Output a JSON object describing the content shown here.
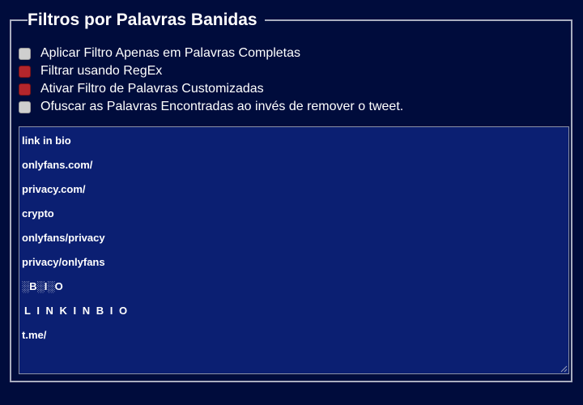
{
  "panel": {
    "title": "Filtros por Palavras Banidas"
  },
  "options": [
    {
      "label": "Aplicar Filtro Apenas em Palavras Completas",
      "checked": false
    },
    {
      "label": "Filtrar usando RegEx",
      "checked": true
    },
    {
      "label": "Ativar Filtro de Palavras Customizadas",
      "checked": true
    },
    {
      "label": "Ofuscar as Palavras Encontradas ao invés de remover o tweet.",
      "checked": false
    }
  ],
  "banned_words": [
    "link in bio",
    "onlyfans.com/",
    "privacy.com/",
    "crypto",
    "onlyfans/privacy",
    "privacy/onlyfans",
    "░B░I░O",
    "L I N K I N B I O",
    "t.me/"
  ],
  "colors": {
    "background": "#000c3c",
    "textarea_background": "#0b1f72",
    "checked": "#b3262c",
    "unchecked": "#cfcfcf",
    "border": "#a9adbf"
  }
}
